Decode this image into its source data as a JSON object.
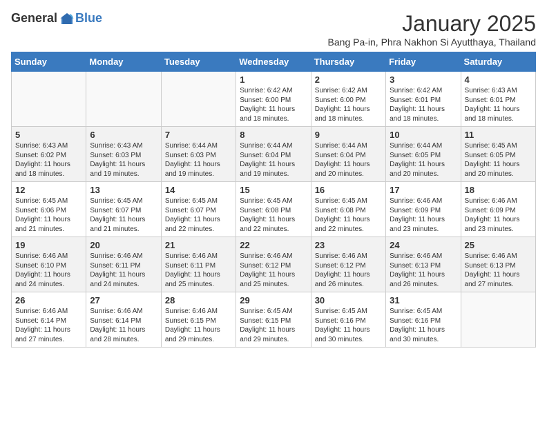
{
  "logo": {
    "general": "General",
    "blue": "Blue"
  },
  "title": "January 2025",
  "subtitle": "Bang Pa-in, Phra Nakhon Si Ayutthaya, Thailand",
  "days_of_week": [
    "Sunday",
    "Monday",
    "Tuesday",
    "Wednesday",
    "Thursday",
    "Friday",
    "Saturday"
  ],
  "weeks": [
    [
      {
        "day": "",
        "info": ""
      },
      {
        "day": "",
        "info": ""
      },
      {
        "day": "",
        "info": ""
      },
      {
        "day": "1",
        "info": "Sunrise: 6:42 AM\nSunset: 6:00 PM\nDaylight: 11 hours and 18 minutes."
      },
      {
        "day": "2",
        "info": "Sunrise: 6:42 AM\nSunset: 6:00 PM\nDaylight: 11 hours and 18 minutes."
      },
      {
        "day": "3",
        "info": "Sunrise: 6:42 AM\nSunset: 6:01 PM\nDaylight: 11 hours and 18 minutes."
      },
      {
        "day": "4",
        "info": "Sunrise: 6:43 AM\nSunset: 6:01 PM\nDaylight: 11 hours and 18 minutes."
      }
    ],
    [
      {
        "day": "5",
        "info": "Sunrise: 6:43 AM\nSunset: 6:02 PM\nDaylight: 11 hours and 18 minutes."
      },
      {
        "day": "6",
        "info": "Sunrise: 6:43 AM\nSunset: 6:03 PM\nDaylight: 11 hours and 19 minutes."
      },
      {
        "day": "7",
        "info": "Sunrise: 6:44 AM\nSunset: 6:03 PM\nDaylight: 11 hours and 19 minutes."
      },
      {
        "day": "8",
        "info": "Sunrise: 6:44 AM\nSunset: 6:04 PM\nDaylight: 11 hours and 19 minutes."
      },
      {
        "day": "9",
        "info": "Sunrise: 6:44 AM\nSunset: 6:04 PM\nDaylight: 11 hours and 20 minutes."
      },
      {
        "day": "10",
        "info": "Sunrise: 6:44 AM\nSunset: 6:05 PM\nDaylight: 11 hours and 20 minutes."
      },
      {
        "day": "11",
        "info": "Sunrise: 6:45 AM\nSunset: 6:05 PM\nDaylight: 11 hours and 20 minutes."
      }
    ],
    [
      {
        "day": "12",
        "info": "Sunrise: 6:45 AM\nSunset: 6:06 PM\nDaylight: 11 hours and 21 minutes."
      },
      {
        "day": "13",
        "info": "Sunrise: 6:45 AM\nSunset: 6:07 PM\nDaylight: 11 hours and 21 minutes."
      },
      {
        "day": "14",
        "info": "Sunrise: 6:45 AM\nSunset: 6:07 PM\nDaylight: 11 hours and 22 minutes."
      },
      {
        "day": "15",
        "info": "Sunrise: 6:45 AM\nSunset: 6:08 PM\nDaylight: 11 hours and 22 minutes."
      },
      {
        "day": "16",
        "info": "Sunrise: 6:45 AM\nSunset: 6:08 PM\nDaylight: 11 hours and 22 minutes."
      },
      {
        "day": "17",
        "info": "Sunrise: 6:46 AM\nSunset: 6:09 PM\nDaylight: 11 hours and 23 minutes."
      },
      {
        "day": "18",
        "info": "Sunrise: 6:46 AM\nSunset: 6:09 PM\nDaylight: 11 hours and 23 minutes."
      }
    ],
    [
      {
        "day": "19",
        "info": "Sunrise: 6:46 AM\nSunset: 6:10 PM\nDaylight: 11 hours and 24 minutes."
      },
      {
        "day": "20",
        "info": "Sunrise: 6:46 AM\nSunset: 6:11 PM\nDaylight: 11 hours and 24 minutes."
      },
      {
        "day": "21",
        "info": "Sunrise: 6:46 AM\nSunset: 6:11 PM\nDaylight: 11 hours and 25 minutes."
      },
      {
        "day": "22",
        "info": "Sunrise: 6:46 AM\nSunset: 6:12 PM\nDaylight: 11 hours and 25 minutes."
      },
      {
        "day": "23",
        "info": "Sunrise: 6:46 AM\nSunset: 6:12 PM\nDaylight: 11 hours and 26 minutes."
      },
      {
        "day": "24",
        "info": "Sunrise: 6:46 AM\nSunset: 6:13 PM\nDaylight: 11 hours and 26 minutes."
      },
      {
        "day": "25",
        "info": "Sunrise: 6:46 AM\nSunset: 6:13 PM\nDaylight: 11 hours and 27 minutes."
      }
    ],
    [
      {
        "day": "26",
        "info": "Sunrise: 6:46 AM\nSunset: 6:14 PM\nDaylight: 11 hours and 27 minutes."
      },
      {
        "day": "27",
        "info": "Sunrise: 6:46 AM\nSunset: 6:14 PM\nDaylight: 11 hours and 28 minutes."
      },
      {
        "day": "28",
        "info": "Sunrise: 6:46 AM\nSunset: 6:15 PM\nDaylight: 11 hours and 29 minutes."
      },
      {
        "day": "29",
        "info": "Sunrise: 6:45 AM\nSunset: 6:15 PM\nDaylight: 11 hours and 29 minutes."
      },
      {
        "day": "30",
        "info": "Sunrise: 6:45 AM\nSunset: 6:16 PM\nDaylight: 11 hours and 30 minutes."
      },
      {
        "day": "31",
        "info": "Sunrise: 6:45 AM\nSunset: 6:16 PM\nDaylight: 11 hours and 30 minutes."
      },
      {
        "day": "",
        "info": ""
      }
    ]
  ]
}
